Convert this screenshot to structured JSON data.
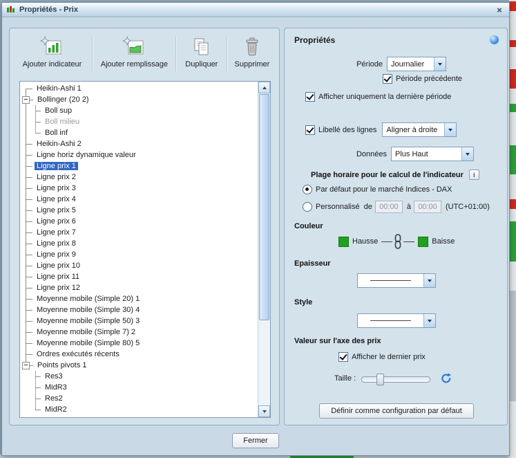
{
  "window": {
    "title": "Propriétés - Prix",
    "close_glyph": "×"
  },
  "toolbar": {
    "buttons": [
      {
        "label": "Ajouter indicateur"
      },
      {
        "label": "Ajouter remplissage"
      },
      {
        "label": "Dupliquer"
      },
      {
        "label": "Supprimer"
      }
    ]
  },
  "tree": {
    "items": [
      {
        "label": "Heikin-Ashi 1",
        "level": 0
      },
      {
        "label": "Bollinger (20 2)",
        "level": 0,
        "expandable": true
      },
      {
        "label": "Boll sup",
        "level": 1
      },
      {
        "label": "Boll milieu",
        "level": 1,
        "muted": true
      },
      {
        "label": "Boll inf",
        "level": 1,
        "last": true
      },
      {
        "label": "Heikin-Ashi 2",
        "level": 0
      },
      {
        "label": "Ligne horiz dynamique valeur",
        "level": 0
      },
      {
        "label": "Ligne prix 1",
        "level": 0,
        "selected": true
      },
      {
        "label": "Ligne prix 2",
        "level": 0
      },
      {
        "label": "Ligne prix 3",
        "level": 0
      },
      {
        "label": "Ligne prix 4",
        "level": 0
      },
      {
        "label": "Ligne prix 5",
        "level": 0
      },
      {
        "label": "Ligne prix 6",
        "level": 0
      },
      {
        "label": "Ligne prix 7",
        "level": 0
      },
      {
        "label": "Ligne prix 8",
        "level": 0
      },
      {
        "label": "Ligne prix 9",
        "level": 0
      },
      {
        "label": "Ligne prix 10",
        "level": 0
      },
      {
        "label": "Ligne prix 11",
        "level": 0
      },
      {
        "label": "Ligne prix 12",
        "level": 0
      },
      {
        "label": "Moyenne mobile (Simple 20) 1",
        "level": 0
      },
      {
        "label": "Moyenne mobile (Simple 30) 4",
        "level": 0
      },
      {
        "label": "Moyenne mobile (Simple 50) 3",
        "level": 0
      },
      {
        "label": "Moyenne mobile (Simple 7) 2",
        "level": 0
      },
      {
        "label": "Moyenne mobile (Simple 80) 5",
        "level": 0
      },
      {
        "label": "Ordres exécutés récents",
        "level": 0
      },
      {
        "label": "Points pivots 1",
        "level": 0,
        "expandable": true
      },
      {
        "label": "Res3",
        "level": 1
      },
      {
        "label": "MidR3",
        "level": 1
      },
      {
        "label": "Res2",
        "level": 1
      },
      {
        "label": "MidR2",
        "level": 1,
        "last": true
      }
    ]
  },
  "properties": {
    "title": "Propriétés",
    "periode": {
      "label": "Période",
      "value": "Journalier"
    },
    "periode_precedente": "Période précédente",
    "afficher_derniere": "Afficher uniquement la dernière période",
    "libelle": {
      "label": "Libellé des lignes",
      "value": "Aligner à droite"
    },
    "donnees": {
      "label": "Données",
      "value": "Plus Haut"
    },
    "plage": {
      "title": "Plage horaire pour le calcul de l'indicateur",
      "info_glyph": "i",
      "option_default": "Par défaut pour le marché Indices - DAX",
      "option_custom": "Personnalisé",
      "de": "de",
      "a": "à",
      "from": "00:00",
      "to": "00:00",
      "utc": "(UTC+01:00)"
    },
    "couleur": {
      "title": "Couleur",
      "hausse": "Hausse",
      "baisse": "Baisse",
      "hausse_color": "#21a121",
      "baisse_color": "#21a121"
    },
    "epaisseur_title": "Epaisseur",
    "style_title": "Style",
    "valeur_title": "Valeur sur l'axe des prix",
    "afficher_dernier_prix": "Afficher le dernier prix",
    "taille_label": "Taille :",
    "default_button": "Définir comme configuration par défaut"
  },
  "footer": {
    "close_button": "Fermer"
  },
  "colors": {
    "selection": "#3166c5",
    "hausse": "#21a121",
    "baisse": "#21a121"
  }
}
